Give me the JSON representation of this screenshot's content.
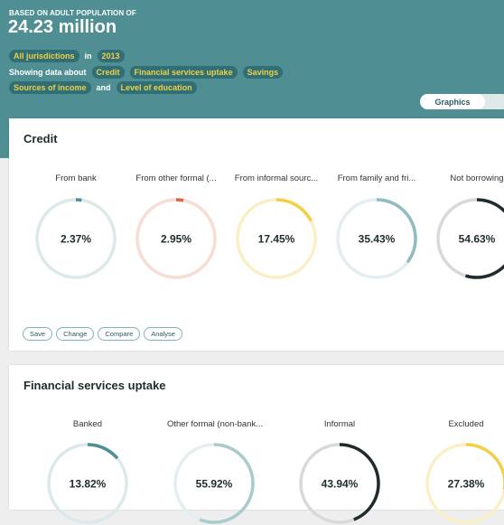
{
  "header": {
    "subtitle": "BASED ON ADULT POPULATION OF",
    "population": "24.23 million",
    "filters_line1": {
      "jurisdiction": "All jurisdictions",
      "in_word": "in",
      "year": "2013"
    },
    "filters_line2": {
      "prefix": "Showing data about",
      "items": [
        "Credit",
        "Financial services uptake",
        "Savings"
      ]
    },
    "filters_line3": {
      "items": [
        "Sources of income",
        "Level of education"
      ],
      "and_word": "and"
    },
    "view_toggle": {
      "active": "Graphics"
    }
  },
  "colors": {
    "header_bg": "#4f8e93",
    "pill_text": "#f2cf46",
    "teal": "#4f8e93",
    "orange": "#e2623c",
    "yellow": "#f2cf46",
    "dark": "#1f2b2d"
  },
  "credit": {
    "title": "Credit",
    "metrics": [
      {
        "label": "From bank",
        "value": "2.37%",
        "fraction": 0.0237,
        "color": "#4f8e93",
        "track": "#dbe9ea"
      },
      {
        "label": "From other formal (...",
        "value": "2.95%",
        "fraction": 0.0295,
        "color": "#e2623c",
        "track": "#f7ddd4"
      },
      {
        "label": "From informal sourc...",
        "value": "17.45%",
        "fraction": 0.1745,
        "color": "#f2cf46",
        "track": "#fbefc6"
      },
      {
        "label": "From family and fri...",
        "value": "35.43%",
        "fraction": 0.3543,
        "color": "#8fbcc0",
        "track": "#e4eef0"
      },
      {
        "label": "Not borrowing",
        "value": "54.63%",
        "fraction": 0.5463,
        "color": "#1f2b2d",
        "track": "#d9d9d9"
      }
    ],
    "actions": [
      "Save",
      "Change",
      "Compare",
      "Analyse"
    ]
  },
  "uptake": {
    "title": "Financial services uptake",
    "metrics": [
      {
        "label": "Banked",
        "value": "13.82%",
        "fraction": 0.1382,
        "color": "#4f8e93",
        "track": "#dbe9ea"
      },
      {
        "label": "Other formal (non-bank...",
        "value": "55.92%",
        "fraction": 0.5592,
        "color": "#a9cbce",
        "track": "#e4eef0"
      },
      {
        "label": "Informal",
        "value": "43.94%",
        "fraction": 0.4394,
        "color": "#1f2b2d",
        "track": "#d9d9d9"
      },
      {
        "label": "Excluded",
        "value": "27.38%",
        "fraction": 0.2738,
        "color": "#f2cf46",
        "track": "#fbefc6"
      }
    ]
  }
}
